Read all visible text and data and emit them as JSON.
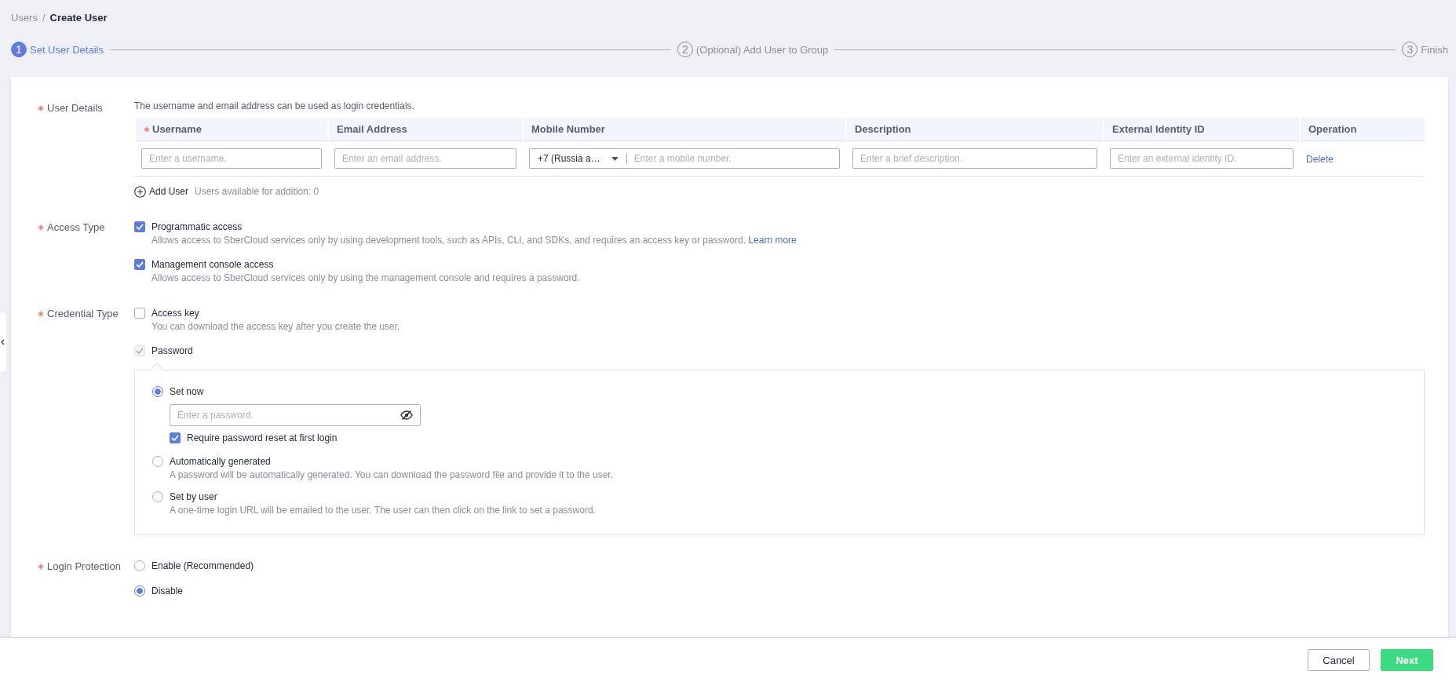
{
  "breadcrumb": {
    "separator": "/",
    "items": [
      {
        "label": "Users",
        "current": false
      },
      {
        "label": "Create User",
        "current": true
      }
    ]
  },
  "steps": [
    {
      "number": "1",
      "label": "Set User Details",
      "selected": true
    },
    {
      "number": "2",
      "label": "(Optional) Add User to Group",
      "selected": false
    },
    {
      "number": "3",
      "label": "Finish",
      "selected": false
    }
  ],
  "user_details": {
    "label": "User Details",
    "required": true,
    "hint": "The username and email address can be used as login credentials.",
    "table": {
      "columns": [
        {
          "label": "Username",
          "required": true
        },
        {
          "label": "Email Address",
          "required": false
        },
        {
          "label": "Mobile Number",
          "required": false
        },
        {
          "label": "Description",
          "required": false
        },
        {
          "label": "External Identity ID",
          "required": false
        },
        {
          "label": "Operation",
          "required": false
        }
      ],
      "rows": [
        {
          "cells": [
            {
              "kind": "input",
              "placeholder": "Enter a username."
            },
            {
              "kind": "input",
              "placeholder": "Enter an email address."
            },
            {
              "kind": "phone",
              "country": "+7 (Russia a…",
              "placeholder": "Enter a mobile number."
            },
            {
              "kind": "input",
              "placeholder": "Enter a brief description."
            },
            {
              "kind": "input",
              "placeholder": "Enter an external identity ID."
            },
            {
              "kind": "link",
              "text": "Delete"
            }
          ]
        }
      ]
    },
    "add_user": {
      "label": "Add User",
      "note": "Users available for addition: 0"
    }
  },
  "access_type": {
    "label": "Access Type",
    "required": true,
    "options": [
      {
        "label": "Programmatic access",
        "checked": true,
        "disabled": false,
        "description": "Allows access to SberCloud services only by using development tools, such as APIs, CLI, and SDKs, and requires an access key or password.",
        "link": "Learn more"
      },
      {
        "label": "Management console access",
        "checked": true,
        "disabled": false,
        "description": "Allows access to SberCloud services only by using the management console and requires a password."
      }
    ]
  },
  "credential_type": {
    "label": "Credential Type",
    "required": true,
    "options": [
      {
        "label": "Access key",
        "checked": false,
        "disabled": false,
        "description": "You can download the access key after you create the user."
      },
      {
        "label": "Password",
        "checked": true,
        "disabled": true
      }
    ],
    "password_panel": {
      "options": [
        {
          "label": "Set now",
          "selected": true,
          "field": {
            "placeholder": "Enter a password."
          },
          "checkbox": {
            "label": "Require password reset at first login",
            "checked": true
          }
        },
        {
          "label": "Automatically generated",
          "selected": false,
          "description": "A password will be automatically generated. You can download the password file and provide it to the user."
        },
        {
          "label": "Set by user",
          "selected": false,
          "description": "A one-time login URL will be emailed to the user. The user can then click on the link to set a password."
        }
      ]
    }
  },
  "login_protection": {
    "label": "Login Protection",
    "required": true,
    "options": [
      {
        "label": "Enable (Recommended)",
        "selected": false
      },
      {
        "label": "Disable",
        "selected": true
      }
    ]
  },
  "footer": {
    "buttons": [
      {
        "label": "Cancel",
        "kind": "secondary"
      },
      {
        "label": "Next",
        "kind": "primary"
      }
    ]
  }
}
